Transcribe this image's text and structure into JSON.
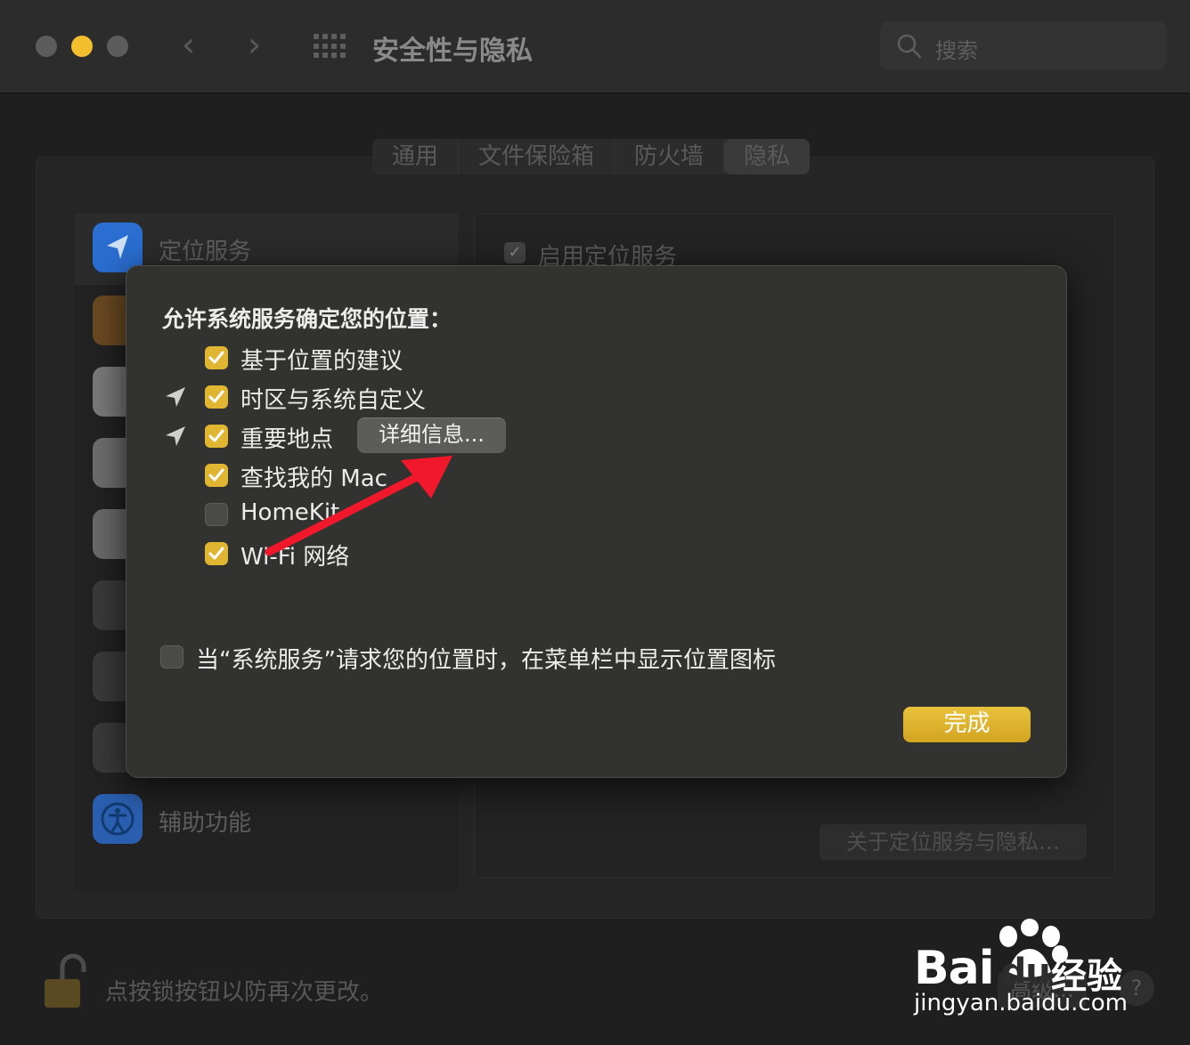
{
  "window": {
    "title": "安全性与隐私",
    "search_placeholder": "搜索",
    "traffic_lights": {
      "close": "#5c5c5c",
      "minimize": "#f4bf2f",
      "zoom": "#5c5c5c"
    }
  },
  "tabs": [
    {
      "label": "通用",
      "selected": false
    },
    {
      "label": "文件保险箱",
      "selected": false
    },
    {
      "label": "防火墙",
      "selected": false
    },
    {
      "label": "隐私",
      "selected": true
    }
  ],
  "sidebar": {
    "items": [
      {
        "label": "定位服务",
        "icon": "location-arrow-icon",
        "color": "#2a6ed1"
      },
      {
        "label": "",
        "icon": "contacts-icon",
        "color": "#a86a2a"
      },
      {
        "label": "",
        "icon": "calendar-icon",
        "color": "#e6e6e6"
      },
      {
        "label": "",
        "icon": "reminders-icon",
        "color": "#d8d8d8"
      },
      {
        "label": "",
        "icon": "photos-icon",
        "color": "#e0e0e0"
      },
      {
        "label": "",
        "icon": "camera-icon",
        "color": "#3a3a3a"
      },
      {
        "label": "",
        "icon": "microphone-icon",
        "color": "#3a3a3a"
      },
      {
        "label": "",
        "icon": "speech-recognition-icon",
        "color": "#3a3a3a"
      },
      {
        "label": "辅助功能",
        "icon": "accessibility-icon",
        "color": "#2a6ed1"
      }
    ]
  },
  "main": {
    "enable_location_label": "启用定位服务",
    "about_button": "关于定位服务与隐私…"
  },
  "footer": {
    "lock_text": "点按锁按钮以防再次更改。",
    "advanced_button": "高级…",
    "help_button": "?"
  },
  "sheet": {
    "title": "允许系统服务确定您的位置：",
    "options": [
      {
        "label": "基于位置的建议",
        "checked": true,
        "location_arrow": false
      },
      {
        "label": "时区与系统自定义",
        "checked": true,
        "location_arrow": true
      },
      {
        "label": "重要地点",
        "checked": true,
        "location_arrow": true
      },
      {
        "label": "查找我的 Mac",
        "checked": true,
        "location_arrow": false
      },
      {
        "label": "HomeKit",
        "checked": false,
        "location_arrow": false
      },
      {
        "label": "Wi-Fi 网络",
        "checked": true,
        "location_arrow": false
      }
    ],
    "details_button": "详细信息...",
    "menu_bar_option": {
      "label": "当“系统服务”请求您的位置时，在菜单栏中显示位置图标",
      "checked": false
    },
    "done_button": "完成"
  },
  "watermark": {
    "brand": "Bai",
    "brand_suffix": "du",
    "product": "经验",
    "url": "jingyan.baidu.com"
  },
  "colors": {
    "accent": "#e0b531",
    "annotation_arrow": "#f0182a"
  }
}
